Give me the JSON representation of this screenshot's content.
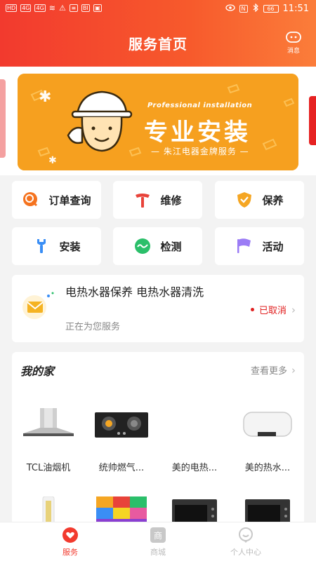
{
  "status_bar": {
    "left_chips": [
      "HD",
      "4G",
      "4G",
      "≋",
      "⚠",
      "≡",
      "BI",
      "▣"
    ],
    "nfc": "N",
    "battery": "66",
    "time": "11:51"
  },
  "header": {
    "title": "服务首页",
    "message_label": "消息"
  },
  "banner": {
    "english": "Professional installation",
    "title": "专业安装",
    "subtitle": "— 朱江电器金牌服务 —"
  },
  "services": [
    {
      "label": "订单查询",
      "icon": "order-search-icon",
      "color": "#f5731f"
    },
    {
      "label": "维修",
      "icon": "hammer-icon",
      "color": "#e8433a"
    },
    {
      "label": "保养",
      "icon": "shield-icon",
      "color": "#f5a623"
    },
    {
      "label": "安装",
      "icon": "wrench-icon",
      "color": "#3a8ef5"
    },
    {
      "label": "检测",
      "icon": "pulse-icon",
      "color": "#2bbf6a"
    },
    {
      "label": "活动",
      "icon": "flag-icon",
      "color": "#9b7cf5"
    }
  ],
  "order_status": {
    "title": "电热水器保养 电热水器清洗",
    "subtitle": "正在为您服务",
    "state": "已取消"
  },
  "my_home": {
    "title": "我的家",
    "more": "查看更多",
    "devices": [
      {
        "name": "TCL油烟机",
        "icon": "range-hood-icon"
      },
      {
        "name": "统帅燃气...",
        "icon": "gas-stove-icon"
      },
      {
        "name": "美的电热...",
        "icon": "water-heater-icon"
      },
      {
        "name": "美的热水...",
        "icon": "water-heater-icon"
      },
      {
        "name": "",
        "icon": "air-conditioner-icon"
      },
      {
        "name": "",
        "icon": "tv-icon"
      },
      {
        "name": "",
        "icon": "oven-icon"
      },
      {
        "name": "",
        "icon": "oven-icon"
      }
    ]
  },
  "bottom_nav": [
    {
      "label": "服务",
      "icon": "heart-icon",
      "active": true
    },
    {
      "label": "商城",
      "icon": "shop-icon",
      "active": false
    },
    {
      "label": "个人中心",
      "icon": "profile-icon",
      "active": false
    }
  ],
  "colors": {
    "brand_red": "#f23a2e",
    "accent_orange": "#f5a623",
    "inactive_gray": "#bbbbbb"
  }
}
